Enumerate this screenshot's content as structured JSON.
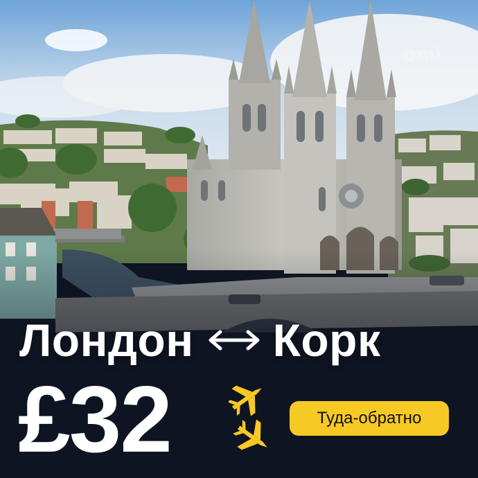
{
  "route": {
    "from": "Лондон",
    "to": "Корк",
    "arrow_icon": "double-arrow-icon"
  },
  "price": {
    "amount": "£32"
  },
  "badge": {
    "label": "Туда-обратно"
  },
  "watermark": "omi",
  "icons": {
    "planes": "airplanes-icon"
  },
  "colors": {
    "accent": "#f7c924",
    "text": "#ffffff",
    "dark": "#0f1422"
  }
}
